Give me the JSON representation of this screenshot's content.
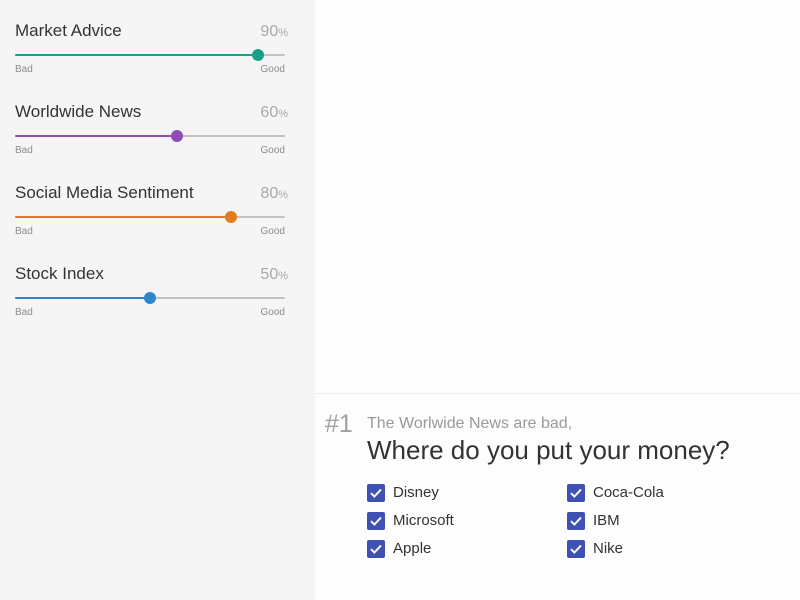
{
  "sliders": [
    {
      "label": "Market Advice",
      "value": "90",
      "unit": "%",
      "min_label": "Bad",
      "max_label": "Good",
      "fraction": 0.9,
      "color": "#17a08a"
    },
    {
      "label": "Worldwide News",
      "value": "60",
      "unit": "%",
      "min_label": "Bad",
      "max_label": "Good",
      "fraction": 0.6,
      "color": "#8e4db0"
    },
    {
      "label": "Social Media Sentiment",
      "value": "80",
      "unit": "%",
      "min_label": "Bad",
      "max_label": "Good",
      "fraction": 0.8,
      "color": "#e07b22"
    },
    {
      "label": "Stock Index",
      "value": "50",
      "unit": "%",
      "min_label": "Bad",
      "max_label": "Good",
      "fraction": 0.5,
      "color": "#2f86d0"
    }
  ],
  "question": {
    "number": "#1",
    "subtitle": "The Worlwide News are bad,",
    "title": "Where do you put your money?"
  },
  "options": [
    {
      "label": "Disney",
      "checked": true
    },
    {
      "label": "Coca-Cola",
      "checked": true
    },
    {
      "label": "Microsoft",
      "checked": true
    },
    {
      "label": "IBM",
      "checked": true
    },
    {
      "label": "Apple",
      "checked": true
    },
    {
      "label": "Nike",
      "checked": true
    }
  ],
  "colors": {
    "checkbox": "#3f51b5",
    "track": "#c2c2c2"
  }
}
